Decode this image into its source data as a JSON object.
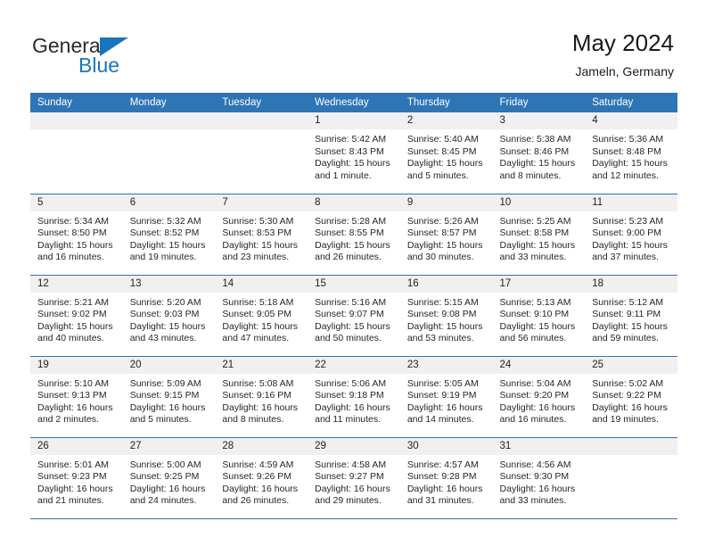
{
  "brand": {
    "name_part1": "General",
    "name_part2": "Blue",
    "accent_color": "#1b75bc",
    "flag_icon": "triangle-flag-icon"
  },
  "header": {
    "title": "May 2024",
    "subtitle": "Jameln, Germany",
    "header_bg_color": "#2e75b6"
  },
  "weekdays": [
    "Sunday",
    "Monday",
    "Tuesday",
    "Wednesday",
    "Thursday",
    "Friday",
    "Saturday"
  ],
  "weeks": [
    [
      {
        "day": "",
        "sunrise": "",
        "sunset": "",
        "daylight_line1": "",
        "daylight_line2": ""
      },
      {
        "day": "",
        "sunrise": "",
        "sunset": "",
        "daylight_line1": "",
        "daylight_line2": ""
      },
      {
        "day": "",
        "sunrise": "",
        "sunset": "",
        "daylight_line1": "",
        "daylight_line2": ""
      },
      {
        "day": "1",
        "sunrise": "Sunrise: 5:42 AM",
        "sunset": "Sunset: 8:43 PM",
        "daylight_line1": "Daylight: 15 hours",
        "daylight_line2": "and 1 minute."
      },
      {
        "day": "2",
        "sunrise": "Sunrise: 5:40 AM",
        "sunset": "Sunset: 8:45 PM",
        "daylight_line1": "Daylight: 15 hours",
        "daylight_line2": "and 5 minutes."
      },
      {
        "day": "3",
        "sunrise": "Sunrise: 5:38 AM",
        "sunset": "Sunset: 8:46 PM",
        "daylight_line1": "Daylight: 15 hours",
        "daylight_line2": "and 8 minutes."
      },
      {
        "day": "4",
        "sunrise": "Sunrise: 5:36 AM",
        "sunset": "Sunset: 8:48 PM",
        "daylight_line1": "Daylight: 15 hours",
        "daylight_line2": "and 12 minutes."
      }
    ],
    [
      {
        "day": "5",
        "sunrise": "Sunrise: 5:34 AM",
        "sunset": "Sunset: 8:50 PM",
        "daylight_line1": "Daylight: 15 hours",
        "daylight_line2": "and 16 minutes."
      },
      {
        "day": "6",
        "sunrise": "Sunrise: 5:32 AM",
        "sunset": "Sunset: 8:52 PM",
        "daylight_line1": "Daylight: 15 hours",
        "daylight_line2": "and 19 minutes."
      },
      {
        "day": "7",
        "sunrise": "Sunrise: 5:30 AM",
        "sunset": "Sunset: 8:53 PM",
        "daylight_line1": "Daylight: 15 hours",
        "daylight_line2": "and 23 minutes."
      },
      {
        "day": "8",
        "sunrise": "Sunrise: 5:28 AM",
        "sunset": "Sunset: 8:55 PM",
        "daylight_line1": "Daylight: 15 hours",
        "daylight_line2": "and 26 minutes."
      },
      {
        "day": "9",
        "sunrise": "Sunrise: 5:26 AM",
        "sunset": "Sunset: 8:57 PM",
        "daylight_line1": "Daylight: 15 hours",
        "daylight_line2": "and 30 minutes."
      },
      {
        "day": "10",
        "sunrise": "Sunrise: 5:25 AM",
        "sunset": "Sunset: 8:58 PM",
        "daylight_line1": "Daylight: 15 hours",
        "daylight_line2": "and 33 minutes."
      },
      {
        "day": "11",
        "sunrise": "Sunrise: 5:23 AM",
        "sunset": "Sunset: 9:00 PM",
        "daylight_line1": "Daylight: 15 hours",
        "daylight_line2": "and 37 minutes."
      }
    ],
    [
      {
        "day": "12",
        "sunrise": "Sunrise: 5:21 AM",
        "sunset": "Sunset: 9:02 PM",
        "daylight_line1": "Daylight: 15 hours",
        "daylight_line2": "and 40 minutes."
      },
      {
        "day": "13",
        "sunrise": "Sunrise: 5:20 AM",
        "sunset": "Sunset: 9:03 PM",
        "daylight_line1": "Daylight: 15 hours",
        "daylight_line2": "and 43 minutes."
      },
      {
        "day": "14",
        "sunrise": "Sunrise: 5:18 AM",
        "sunset": "Sunset: 9:05 PM",
        "daylight_line1": "Daylight: 15 hours",
        "daylight_line2": "and 47 minutes."
      },
      {
        "day": "15",
        "sunrise": "Sunrise: 5:16 AM",
        "sunset": "Sunset: 9:07 PM",
        "daylight_line1": "Daylight: 15 hours",
        "daylight_line2": "and 50 minutes."
      },
      {
        "day": "16",
        "sunrise": "Sunrise: 5:15 AM",
        "sunset": "Sunset: 9:08 PM",
        "daylight_line1": "Daylight: 15 hours",
        "daylight_line2": "and 53 minutes."
      },
      {
        "day": "17",
        "sunrise": "Sunrise: 5:13 AM",
        "sunset": "Sunset: 9:10 PM",
        "daylight_line1": "Daylight: 15 hours",
        "daylight_line2": "and 56 minutes."
      },
      {
        "day": "18",
        "sunrise": "Sunrise: 5:12 AM",
        "sunset": "Sunset: 9:11 PM",
        "daylight_line1": "Daylight: 15 hours",
        "daylight_line2": "and 59 minutes."
      }
    ],
    [
      {
        "day": "19",
        "sunrise": "Sunrise: 5:10 AM",
        "sunset": "Sunset: 9:13 PM",
        "daylight_line1": "Daylight: 16 hours",
        "daylight_line2": "and 2 minutes."
      },
      {
        "day": "20",
        "sunrise": "Sunrise: 5:09 AM",
        "sunset": "Sunset: 9:15 PM",
        "daylight_line1": "Daylight: 16 hours",
        "daylight_line2": "and 5 minutes."
      },
      {
        "day": "21",
        "sunrise": "Sunrise: 5:08 AM",
        "sunset": "Sunset: 9:16 PM",
        "daylight_line1": "Daylight: 16 hours",
        "daylight_line2": "and 8 minutes."
      },
      {
        "day": "22",
        "sunrise": "Sunrise: 5:06 AM",
        "sunset": "Sunset: 9:18 PM",
        "daylight_line1": "Daylight: 16 hours",
        "daylight_line2": "and 11 minutes."
      },
      {
        "day": "23",
        "sunrise": "Sunrise: 5:05 AM",
        "sunset": "Sunset: 9:19 PM",
        "daylight_line1": "Daylight: 16 hours",
        "daylight_line2": "and 14 minutes."
      },
      {
        "day": "24",
        "sunrise": "Sunrise: 5:04 AM",
        "sunset": "Sunset: 9:20 PM",
        "daylight_line1": "Daylight: 16 hours",
        "daylight_line2": "and 16 minutes."
      },
      {
        "day": "25",
        "sunrise": "Sunrise: 5:02 AM",
        "sunset": "Sunset: 9:22 PM",
        "daylight_line1": "Daylight: 16 hours",
        "daylight_line2": "and 19 minutes."
      }
    ],
    [
      {
        "day": "26",
        "sunrise": "Sunrise: 5:01 AM",
        "sunset": "Sunset: 9:23 PM",
        "daylight_line1": "Daylight: 16 hours",
        "daylight_line2": "and 21 minutes."
      },
      {
        "day": "27",
        "sunrise": "Sunrise: 5:00 AM",
        "sunset": "Sunset: 9:25 PM",
        "daylight_line1": "Daylight: 16 hours",
        "daylight_line2": "and 24 minutes."
      },
      {
        "day": "28",
        "sunrise": "Sunrise: 4:59 AM",
        "sunset": "Sunset: 9:26 PM",
        "daylight_line1": "Daylight: 16 hours",
        "daylight_line2": "and 26 minutes."
      },
      {
        "day": "29",
        "sunrise": "Sunrise: 4:58 AM",
        "sunset": "Sunset: 9:27 PM",
        "daylight_line1": "Daylight: 16 hours",
        "daylight_line2": "and 29 minutes."
      },
      {
        "day": "30",
        "sunrise": "Sunrise: 4:57 AM",
        "sunset": "Sunset: 9:28 PM",
        "daylight_line1": "Daylight: 16 hours",
        "daylight_line2": "and 31 minutes."
      },
      {
        "day": "31",
        "sunrise": "Sunrise: 4:56 AM",
        "sunset": "Sunset: 9:30 PM",
        "daylight_line1": "Daylight: 16 hours",
        "daylight_line2": "and 33 minutes."
      },
      {
        "day": "",
        "sunrise": "",
        "sunset": "",
        "daylight_line1": "",
        "daylight_line2": ""
      }
    ]
  ]
}
